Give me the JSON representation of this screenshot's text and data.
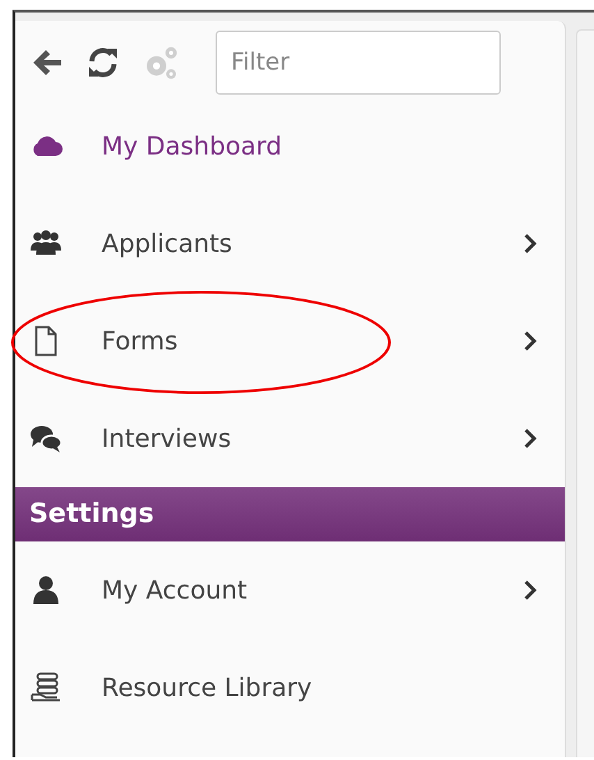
{
  "toolbar": {
    "filter": {
      "placeholder": "Filter"
    },
    "settings_disabled": true
  },
  "menu": [
    {
      "label": "My Dashboard",
      "kind": "cloud",
      "selected": true,
      "chevron": false,
      "highlighted": false
    },
    {
      "label": "Applicants",
      "kind": "users",
      "selected": false,
      "chevron": true,
      "highlighted": false
    },
    {
      "label": "Forms",
      "kind": "file",
      "selected": false,
      "chevron": true,
      "highlighted": true
    },
    {
      "label": "Interviews",
      "kind": "chat",
      "selected": false,
      "chevron": true,
      "highlighted": false
    }
  ],
  "settings": {
    "heading": "Settings",
    "items": [
      {
        "label": "My Account",
        "kind": "user",
        "selected": false,
        "chevron": true
      },
      {
        "label": "Resource Library",
        "kind": "library",
        "selected": false,
        "chevron": false
      }
    ]
  }
}
